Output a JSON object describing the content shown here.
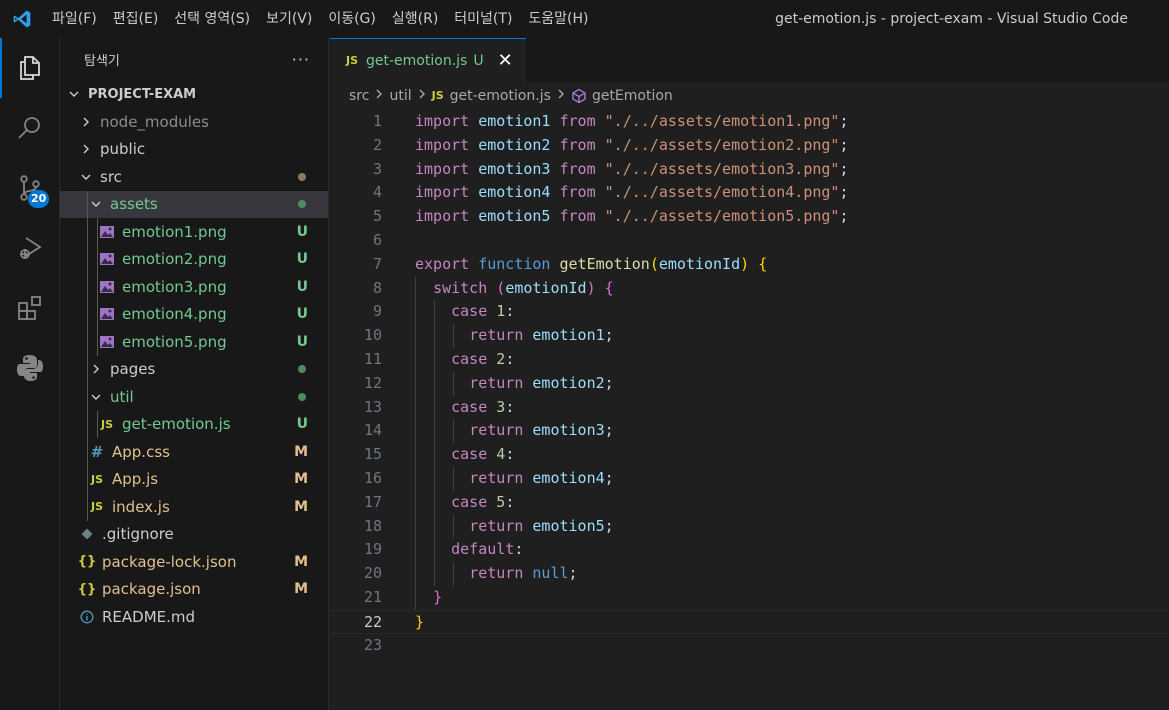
{
  "window": {
    "title": "get-emotion.js - project-exam - Visual Studio Code"
  },
  "menu": [
    "파일(F)",
    "편집(E)",
    "선택 영역(S)",
    "보기(V)",
    "이동(G)",
    "실행(R)",
    "터미널(T)",
    "도움말(H)"
  ],
  "activity_bar": {
    "scm_badge": "20"
  },
  "explorer": {
    "title": "탐색기",
    "more": "···",
    "project": "PROJECT-EXAM",
    "items": [
      {
        "label": "node_modules",
        "type": "folder",
        "expanded": false,
        "depth": 1,
        "color": "dim",
        "status": ""
      },
      {
        "label": "public",
        "type": "folder",
        "expanded": false,
        "depth": 1,
        "color": "def",
        "status": ""
      },
      {
        "label": "src",
        "type": "folder",
        "expanded": true,
        "depth": 1,
        "color": "def",
        "status": "dot-mod"
      },
      {
        "label": "assets",
        "type": "folder",
        "expanded": true,
        "depth": 2,
        "color": "green",
        "status": "dot-green",
        "selected": true
      },
      {
        "label": "emotion1.png",
        "type": "image",
        "depth": 3,
        "color": "green",
        "status": "U"
      },
      {
        "label": "emotion2.png",
        "type": "image",
        "depth": 3,
        "color": "green",
        "status": "U"
      },
      {
        "label": "emotion3.png",
        "type": "image",
        "depth": 3,
        "color": "green",
        "status": "U"
      },
      {
        "label": "emotion4.png",
        "type": "image",
        "depth": 3,
        "color": "green",
        "status": "U"
      },
      {
        "label": "emotion5.png",
        "type": "image",
        "depth": 3,
        "color": "green",
        "status": "U"
      },
      {
        "label": "pages",
        "type": "folder",
        "expanded": false,
        "depth": 2,
        "color": "def",
        "status": "dot-green"
      },
      {
        "label": "util",
        "type": "folder",
        "expanded": true,
        "depth": 2,
        "color": "green",
        "status": "dot-green"
      },
      {
        "label": "get-emotion.js",
        "type": "js",
        "depth": 3,
        "color": "green",
        "status": "U"
      },
      {
        "label": "App.css",
        "type": "css",
        "depth": 2,
        "color": "mod",
        "status": "M"
      },
      {
        "label": "App.js",
        "type": "js",
        "depth": 2,
        "color": "mod",
        "status": "M"
      },
      {
        "label": "index.js",
        "type": "js",
        "depth": 2,
        "color": "mod",
        "status": "M"
      },
      {
        "label": ".gitignore",
        "type": "git",
        "depth": 1,
        "color": "def",
        "status": ""
      },
      {
        "label": "package-lock.json",
        "type": "json",
        "depth": 1,
        "color": "mod",
        "status": "M"
      },
      {
        "label": "package.json",
        "type": "json",
        "depth": 1,
        "color": "mod",
        "status": "M"
      },
      {
        "label": "README.md",
        "type": "info",
        "depth": 1,
        "color": "def",
        "status": ""
      }
    ]
  },
  "editor": {
    "tab": {
      "icon": "JS",
      "name": "get-emotion.js",
      "status": "U",
      "close": "✕"
    },
    "breadcrumb": {
      "src": "src",
      "util": "util",
      "file_icon": "JS",
      "file": "get-emotion.js",
      "symbol": "getEmotion"
    },
    "current_line": 22,
    "lines": [
      [
        [
          "import",
          "k-purple"
        ],
        [
          " ",
          ""
        ],
        [
          "emotion1",
          "v-light"
        ],
        [
          " ",
          ""
        ],
        [
          "from",
          "k-purple"
        ],
        [
          " ",
          ""
        ],
        [
          "\"./../assets/emotion1.png\"",
          "str"
        ],
        [
          ";",
          "pun"
        ]
      ],
      [
        [
          "import",
          "k-purple"
        ],
        [
          " ",
          ""
        ],
        [
          "emotion2",
          "v-light"
        ],
        [
          " ",
          ""
        ],
        [
          "from",
          "k-purple"
        ],
        [
          " ",
          ""
        ],
        [
          "\"./../assets/emotion2.png\"",
          "str"
        ],
        [
          ";",
          "pun"
        ]
      ],
      [
        [
          "import",
          "k-purple"
        ],
        [
          " ",
          ""
        ],
        [
          "emotion3",
          "v-light"
        ],
        [
          " ",
          ""
        ],
        [
          "from",
          "k-purple"
        ],
        [
          " ",
          ""
        ],
        [
          "\"./../assets/emotion3.png\"",
          "str"
        ],
        [
          ";",
          "pun"
        ]
      ],
      [
        [
          "import",
          "k-purple"
        ],
        [
          " ",
          ""
        ],
        [
          "emotion4",
          "v-light"
        ],
        [
          " ",
          ""
        ],
        [
          "from",
          "k-purple"
        ],
        [
          " ",
          ""
        ],
        [
          "\"./../assets/emotion4.png\"",
          "str"
        ],
        [
          ";",
          "pun"
        ]
      ],
      [
        [
          "import",
          "k-purple"
        ],
        [
          " ",
          ""
        ],
        [
          "emotion5",
          "v-light"
        ],
        [
          " ",
          ""
        ],
        [
          "from",
          "k-purple"
        ],
        [
          " ",
          ""
        ],
        [
          "\"./../assets/emotion5.png\"",
          "str"
        ],
        [
          ";",
          "pun"
        ]
      ],
      [],
      [
        [
          "export",
          "k-purple"
        ],
        [
          " ",
          ""
        ],
        [
          "function",
          "k-blue"
        ],
        [
          " ",
          ""
        ],
        [
          "getEmotion",
          "fn"
        ],
        [
          "(",
          "br1"
        ],
        [
          "emotionId",
          "v-light"
        ],
        [
          ")",
          "br1"
        ],
        [
          " ",
          ""
        ],
        [
          "{",
          "br1"
        ]
      ],
      [
        [
          "  ",
          ""
        ],
        [
          "switch",
          "k-purple"
        ],
        [
          " ",
          ""
        ],
        [
          "(",
          "br2"
        ],
        [
          "emotionId",
          "v-light"
        ],
        [
          ")",
          "br2"
        ],
        [
          " ",
          ""
        ],
        [
          "{",
          "br2"
        ]
      ],
      [
        [
          "    ",
          ""
        ],
        [
          "case",
          "k-purple"
        ],
        [
          " ",
          ""
        ],
        [
          "1",
          "num"
        ],
        [
          ":",
          "pun"
        ]
      ],
      [
        [
          "      ",
          ""
        ],
        [
          "return",
          "k-purple"
        ],
        [
          " ",
          ""
        ],
        [
          "emotion1",
          "v-light"
        ],
        [
          ";",
          "pun"
        ]
      ],
      [
        [
          "    ",
          ""
        ],
        [
          "case",
          "k-purple"
        ],
        [
          " ",
          ""
        ],
        [
          "2",
          "num"
        ],
        [
          ":",
          "pun"
        ]
      ],
      [
        [
          "      ",
          ""
        ],
        [
          "return",
          "k-purple"
        ],
        [
          " ",
          ""
        ],
        [
          "emotion2",
          "v-light"
        ],
        [
          ";",
          "pun"
        ]
      ],
      [
        [
          "    ",
          ""
        ],
        [
          "case",
          "k-purple"
        ],
        [
          " ",
          ""
        ],
        [
          "3",
          "num"
        ],
        [
          ":",
          "pun"
        ]
      ],
      [
        [
          "      ",
          ""
        ],
        [
          "return",
          "k-purple"
        ],
        [
          " ",
          ""
        ],
        [
          "emotion3",
          "v-light"
        ],
        [
          ";",
          "pun"
        ]
      ],
      [
        [
          "    ",
          ""
        ],
        [
          "case",
          "k-purple"
        ],
        [
          " ",
          ""
        ],
        [
          "4",
          "num"
        ],
        [
          ":",
          "pun"
        ]
      ],
      [
        [
          "      ",
          ""
        ],
        [
          "return",
          "k-purple"
        ],
        [
          " ",
          ""
        ],
        [
          "emotion4",
          "v-light"
        ],
        [
          ";",
          "pun"
        ]
      ],
      [
        [
          "    ",
          ""
        ],
        [
          "case",
          "k-purple"
        ],
        [
          " ",
          ""
        ],
        [
          "5",
          "num"
        ],
        [
          ":",
          "pun"
        ]
      ],
      [
        [
          "      ",
          ""
        ],
        [
          "return",
          "k-purple"
        ],
        [
          " ",
          ""
        ],
        [
          "emotion5",
          "v-light"
        ],
        [
          ";",
          "pun"
        ]
      ],
      [
        [
          "    ",
          ""
        ],
        [
          "default",
          "k-purple"
        ],
        [
          ":",
          "pun"
        ]
      ],
      [
        [
          "      ",
          ""
        ],
        [
          "return",
          "k-purple"
        ],
        [
          " ",
          ""
        ],
        [
          "null",
          "k-blue"
        ],
        [
          ";",
          "pun"
        ]
      ],
      [
        [
          "  ",
          ""
        ],
        [
          "}",
          "br2"
        ]
      ],
      [
        [
          "}",
          "br1"
        ]
      ],
      []
    ]
  }
}
